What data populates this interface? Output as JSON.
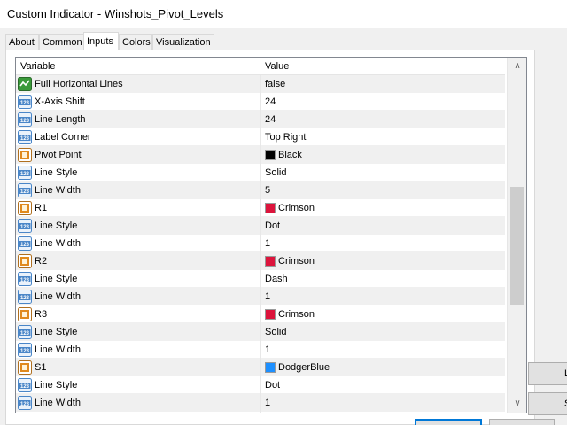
{
  "window": {
    "title": "Custom Indicator - Winshots_Pivot_Levels"
  },
  "tabs": [
    {
      "label": "About"
    },
    {
      "label": "Common"
    },
    {
      "label": "Inputs"
    },
    {
      "label": "Colors"
    },
    {
      "label": "Visualization"
    }
  ],
  "active_tab": "Inputs",
  "grid": {
    "headers": {
      "variable": "Variable",
      "value": "Value"
    },
    "rows": [
      {
        "variable": "Full Horizontal Lines",
        "value": "false",
        "icon": "bool-icon"
      },
      {
        "variable": "X-Axis Shift",
        "value": "24",
        "icon": "int-icon"
      },
      {
        "variable": "Line Length",
        "value": "24",
        "icon": "int-icon"
      },
      {
        "variable": "Label Corner",
        "value": "Top Right",
        "icon": "int-icon"
      },
      {
        "variable": "Pivot Point",
        "value": "Black",
        "icon": "color-icon",
        "swatch": "#000000"
      },
      {
        "variable": "Line Style",
        "value": "Solid",
        "icon": "int-icon"
      },
      {
        "variable": "Line Width",
        "value": "5",
        "icon": "int-icon"
      },
      {
        "variable": "R1",
        "value": "Crimson",
        "icon": "color-icon",
        "swatch": "#dc143c"
      },
      {
        "variable": "Line Style",
        "value": "Dot",
        "icon": "int-icon"
      },
      {
        "variable": "Line Width",
        "value": "1",
        "icon": "int-icon"
      },
      {
        "variable": "R2",
        "value": "Crimson",
        "icon": "color-icon",
        "swatch": "#dc143c"
      },
      {
        "variable": "Line Style",
        "value": "Dash",
        "icon": "int-icon"
      },
      {
        "variable": "Line Width",
        "value": "1",
        "icon": "int-icon"
      },
      {
        "variable": "R3",
        "value": "Crimson",
        "icon": "color-icon",
        "swatch": "#dc143c"
      },
      {
        "variable": "Line Style",
        "value": "Solid",
        "icon": "int-icon"
      },
      {
        "variable": "Line Width",
        "value": "1",
        "icon": "int-icon"
      },
      {
        "variable": "S1",
        "value": "DodgerBlue",
        "icon": "color-icon",
        "swatch": "#1e90ff"
      },
      {
        "variable": "Line Style",
        "value": "Dot",
        "icon": "int-icon"
      },
      {
        "variable": "Line Width",
        "value": "1",
        "icon": "int-icon"
      },
      {
        "variable": "",
        "value": "",
        "icon": "color-icon",
        "swatch": "#1e90ff"
      }
    ]
  },
  "side_buttons": [
    {
      "label": "L"
    },
    {
      "label": "S"
    }
  ],
  "colors": {
    "int_icon": "#4a86c8",
    "bool_icon": "#3a9a3a",
    "color_icon": "#e08a1e",
    "accent": "#0078d7"
  }
}
